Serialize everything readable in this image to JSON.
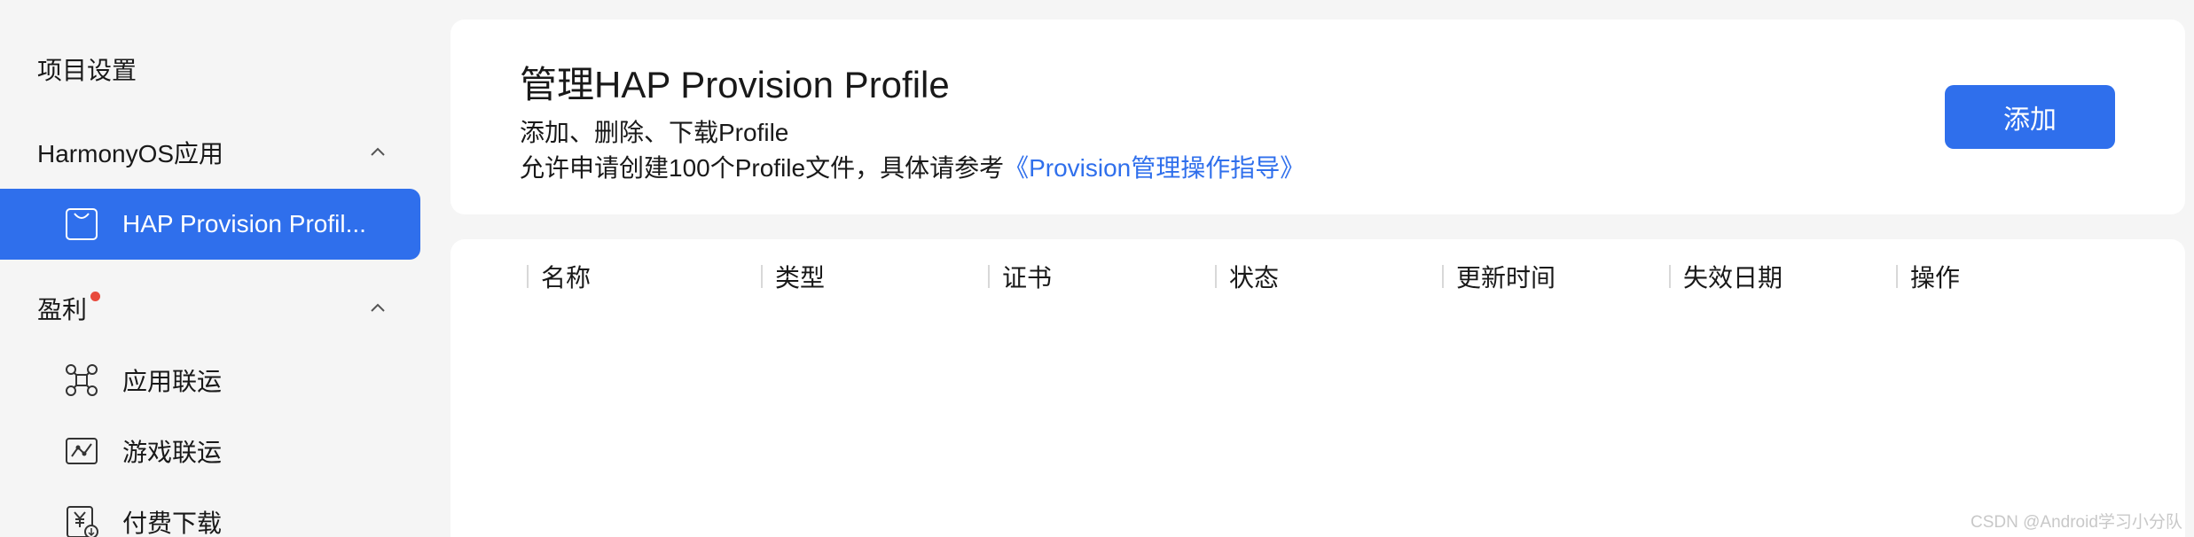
{
  "sidebar": {
    "title": "项目设置",
    "groups": [
      {
        "label": "HarmonyOS应用",
        "expanded": true
      },
      {
        "label": "盈利",
        "expanded": true,
        "has_dot": true
      }
    ],
    "items": [
      {
        "label": "HAP Provision Profil...",
        "icon": "bag-icon",
        "active": true
      },
      {
        "label": "应用联运",
        "icon": "network-nodes-icon"
      },
      {
        "label": "游戏联运",
        "icon": "game-chart-icon"
      },
      {
        "label": "付费下载",
        "icon": "yuan-download-icon"
      }
    ]
  },
  "header": {
    "title": "管理HAP Provision Profile",
    "subtitle1": "添加、删除、下载Profile",
    "subtitle2_prefix": "允许申请创建100个Profile文件，具体请参考",
    "subtitle2_link": "《Provision管理操作指导》",
    "add_button": "添加"
  },
  "table": {
    "columns": [
      "名称",
      "类型",
      "证书",
      "状态",
      "更新时间",
      "失效日期",
      "操作"
    ]
  },
  "watermark": "CSDN @Android学习小分队",
  "colors": {
    "accent": "#2f6fec",
    "dot": "#e84a3c",
    "background": "#f5f5f5"
  }
}
